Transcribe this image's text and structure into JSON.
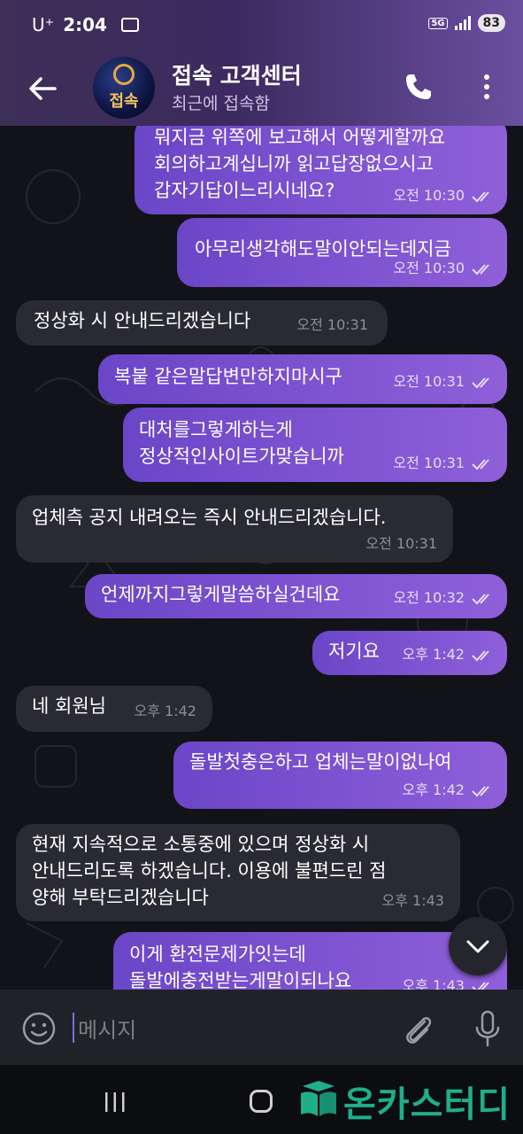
{
  "status_bar": {
    "carrier": "U⁺",
    "time": "2:04",
    "network": "5G",
    "battery": "83"
  },
  "header": {
    "title": "접속 고객센터",
    "subtitle": "최근에 접속함",
    "avatar_text": "접속",
    "back_icon": "arrow-left-icon",
    "call_icon": "phone-icon",
    "menu_icon": "more-vertical-icon"
  },
  "messages": [
    {
      "direction": "out",
      "text": "뭐지금 위쪽에 보고해서 어떻게할까요\n회의하고계십니까 읽고답장없으시고\n갑자기답이느리시네요?",
      "time": "오전 10:30",
      "read": true
    },
    {
      "direction": "out",
      "text": "아무리생각해도말이안되는데지금",
      "time": "오전 10:30",
      "read": true
    },
    {
      "direction": "in",
      "text": "정상화 시 안내드리겠습니다",
      "time": "오전 10:31"
    },
    {
      "direction": "out",
      "text": "복붙 같은말답변만하지마시구",
      "time": "오전 10:31",
      "read": true
    },
    {
      "direction": "out",
      "text": "대처를그렇게하는게\n정상적인사이트가맞습니까",
      "time": "오전 10:31",
      "read": true
    },
    {
      "direction": "in",
      "text": "업체측 공지 내려오는 즉시 안내드리겠습니다.",
      "time": "오전 10:31"
    },
    {
      "direction": "out",
      "text": "언제까지그렇게말씀하실건데요",
      "time": "오전 10:32",
      "read": true
    },
    {
      "direction": "out",
      "text": "저기요",
      "time": "오후 1:42",
      "read": true
    },
    {
      "direction": "in",
      "text": "네 회원님",
      "time": "오후 1:42"
    },
    {
      "direction": "out",
      "text": "돌발첫충은하고 업체는말이없나여",
      "time": "오후 1:42",
      "read": true
    },
    {
      "direction": "in",
      "text": "현재 지속적으로 소통중에 있으며 정상화 시\n안내드리도록 하겠습니다. 이용에 불편드린 점\n양해 부탁드리겠습니다",
      "time": "오후 1:43"
    },
    {
      "direction": "out",
      "text": "이게 환전문제가잇는데\n돌발에충전받는게말이되나요",
      "time": "오후 1:43",
      "read": true
    }
  ],
  "input": {
    "placeholder": "메시지",
    "emoji_icon": "emoji-icon",
    "attach_icon": "paperclip-icon",
    "mic_icon": "microphone-icon"
  },
  "watermark": {
    "text": "온카스터디"
  },
  "colors": {
    "header_left": "#3c2f58",
    "header_right": "#6b4fa0",
    "outgoing_bubble": "#7d52d0",
    "incoming_bubble": "#2a2b32",
    "chat_background": "#121318",
    "watermark": "#1fae8a"
  }
}
